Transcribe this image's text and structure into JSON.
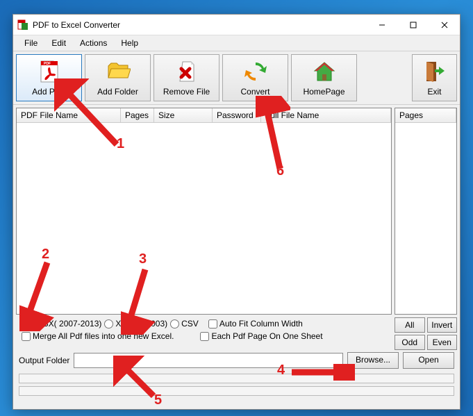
{
  "window": {
    "title": "PDF to Excel Converter"
  },
  "menubar": {
    "file": "File",
    "edit": "Edit",
    "actions": "Actions",
    "help": "Help"
  },
  "toolbar": {
    "add_pdf": "Add PDF",
    "add_folder": "Add Folder",
    "remove_file": "Remove File",
    "convert": "Convert",
    "homepage": "HomePage",
    "exit": "Exit"
  },
  "columns": {
    "name": "PDF File Name",
    "pages": "Pages",
    "size": "Size",
    "password": "Password",
    "fullname": "Full File Name"
  },
  "sidecol": {
    "pages": "Pages"
  },
  "format": {
    "xlsx": "XLSX( 2007-2013)",
    "xls": "XLS(97-2003)",
    "csv": "CSV",
    "autofit": "Auto Fit Column Width",
    "merge": "Merge All Pdf files into one new Excel.",
    "eachpage": "Each Pdf Page On One Sheet"
  },
  "sidebtn": {
    "all": "All",
    "invert": "Invert",
    "odd": "Odd",
    "even": "Even"
  },
  "output": {
    "label": "Output Folder",
    "value": "",
    "browse": "Browse...",
    "open": "Open"
  },
  "annotations": {
    "n1": "1",
    "n2": "2",
    "n3": "3",
    "n4": "4",
    "n5": "5",
    "n6": "6"
  }
}
